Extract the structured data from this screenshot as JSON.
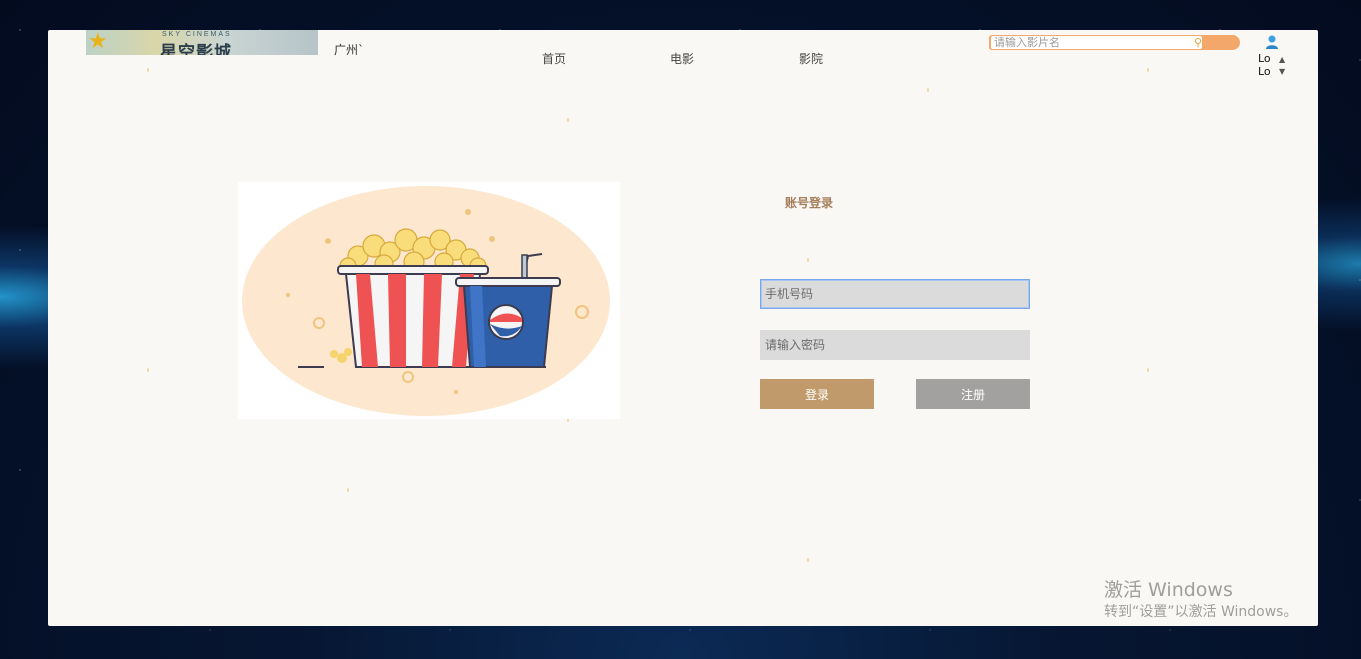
{
  "header": {
    "logo_sub": "SKY CINEMAS",
    "logo_main": "星空影城",
    "city": "广州`",
    "nav": [
      "首页",
      "电影",
      "影院"
    ],
    "search_placeholder": "请输入影片名",
    "user_list": [
      "Lo",
      "Lo"
    ]
  },
  "login": {
    "title": "账号登录",
    "phone_placeholder": "手机号码",
    "password_placeholder": "请输入密码",
    "login_label": "登录",
    "register_label": "注册"
  },
  "watermark": {
    "line1": "激活 Windows",
    "line2": "转到“设置”以激活 Windows。"
  },
  "colors": {
    "accent_login": "#c19a6b",
    "register_gray": "#a3a1a0",
    "search_orange": "#f4a76a",
    "title_brown": "#a57f5c"
  }
}
